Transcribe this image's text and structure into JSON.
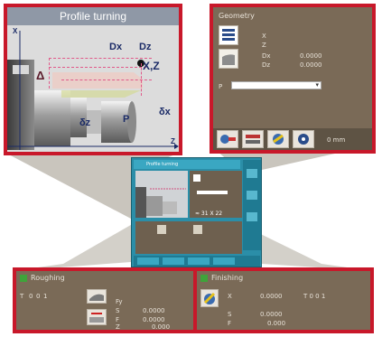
{
  "profile_panel": {
    "title": "Profile turning",
    "labels": {
      "dx": "Dx",
      "dz": "Dz",
      "xz": "X,Z",
      "delta": "Δ",
      "dz_small": "δz",
      "dx_small": "δx",
      "p": "P",
      "axis_x": "X",
      "axis_z": "Z"
    }
  },
  "geometry_panel": {
    "title": "Geometry",
    "fields": [
      {
        "label": "X",
        "value": ""
      },
      {
        "label": "Z",
        "value": ""
      },
      {
        "label": "Dx",
        "value": "0.0000"
      },
      {
        "label": "Dz",
        "value": "0.0000"
      }
    ],
    "p_label": "P",
    "dropdown_value": "",
    "softkey_text": "0 mm"
  },
  "center_screen": {
    "title": "Profile turning",
    "readout": "≈ 31 X 22"
  },
  "roughing_panel": {
    "title": "Roughing",
    "row_labels": [
      "T",
      "0",
      "0",
      "1"
    ],
    "params": [
      {
        "label": "Fy",
        "value": ""
      },
      {
        "label": "S",
        "value": "0.0000"
      },
      {
        "label": "F",
        "value": "0.0000"
      },
      {
        "label": "Z",
        "value": "0.000"
      }
    ]
  },
  "finishing_panel": {
    "title": "Finishing",
    "rows": [
      {
        "label": "X",
        "value": "0.0000",
        "extra": "T  0  0  1"
      },
      {
        "label": "S",
        "value": "0.0000",
        "extra": ""
      },
      {
        "label": "F",
        "value": "0.000",
        "extra": ""
      }
    ]
  },
  "colors": {
    "frame_red": "#c8182a",
    "panel_brown": "#7a6a57",
    "screen_teal": "#2b8ea8"
  }
}
